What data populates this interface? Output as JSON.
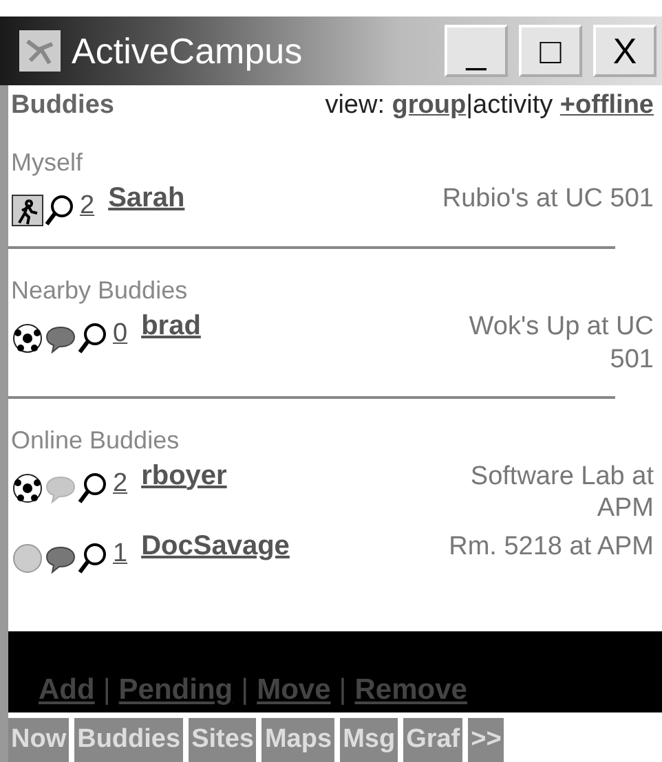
{
  "window": {
    "title": "ActiveCampus",
    "controls": [
      "_",
      "□",
      "X"
    ]
  },
  "header": {
    "title": "Buddies",
    "view_label": "view:",
    "separator": "|",
    "view_options": [
      {
        "label": "group",
        "selected": false
      },
      {
        "label": "activity",
        "selected": true
      }
    ],
    "offline_link": "+offline"
  },
  "sections": [
    {
      "heading": "Myself",
      "buddies": [
        {
          "icons": [
            {
              "kind": "walker",
              "dim": false
            }
          ],
          "count": "2",
          "name": "Sarah",
          "location_lines": [
            "Rubio's at UC 501"
          ]
        }
      ]
    },
    {
      "heading": "Nearby Buddies",
      "buddies": [
        {
          "icons": [
            {
              "kind": "soccer",
              "dim": false
            },
            {
              "kind": "chat",
              "dim": false
            }
          ],
          "count": "0",
          "name": "brad",
          "location_lines": [
            "Wok's Up at UC",
            "501"
          ]
        }
      ]
    },
    {
      "heading": "Online Buddies",
      "buddies": [
        {
          "icons": [
            {
              "kind": "soccer",
              "dim": false
            },
            {
              "kind": "chat",
              "dim": true
            }
          ],
          "count": "2",
          "name": "rboyer",
          "location_lines": [
            "Software Lab at",
            "APM"
          ]
        },
        {
          "icons": [
            {
              "kind": "ball",
              "dim": false
            },
            {
              "kind": "chat",
              "dim": false
            }
          ],
          "count": "1",
          "name": "DocSavage",
          "location_lines": [
            "Rm. 5218 at APM"
          ]
        }
      ]
    }
  ],
  "actions": {
    "separator": "|",
    "items": [
      "Add",
      "Pending",
      "Move",
      "Remove"
    ]
  },
  "nav": [
    {
      "label": "Now"
    },
    {
      "label": "Buddies"
    },
    {
      "label": "Sites"
    },
    {
      "label": "Maps"
    },
    {
      "label": "Msg"
    },
    {
      "label": "Graf"
    },
    {
      "label": ">>"
    }
  ]
}
